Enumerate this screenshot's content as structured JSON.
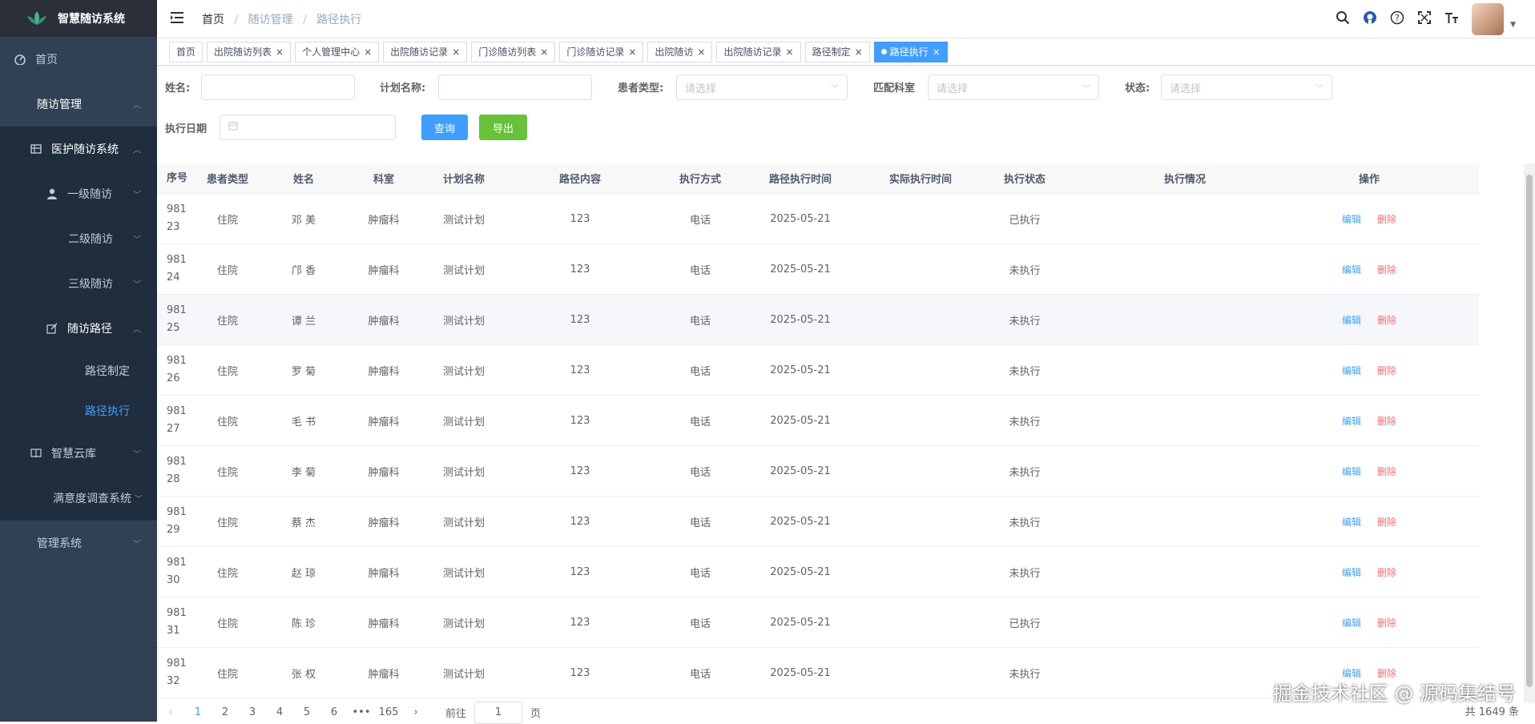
{
  "app": {
    "title": "智慧随访系统"
  },
  "sidebar": {
    "items": [
      {
        "label": "首页",
        "icon": "dashboard-icon"
      },
      {
        "label": "随访管理",
        "icon": ""
      },
      {
        "label": "医护随访系统",
        "icon": "table-icon"
      },
      {
        "label": "一级随访",
        "icon": "user-icon"
      },
      {
        "label": "二级随访",
        "icon": ""
      },
      {
        "label": "三级随访",
        "icon": ""
      },
      {
        "label": "随访路径",
        "icon": "edit-icon"
      },
      {
        "label": "路径制定",
        "icon": ""
      },
      {
        "label": "路径执行",
        "icon": ""
      },
      {
        "label": "智慧云库",
        "icon": "book-icon"
      },
      {
        "label": "满意度调查系统",
        "icon": ""
      },
      {
        "label": "管理系统",
        "icon": ""
      }
    ]
  },
  "breadcrumb": {
    "home": "首页",
    "section": "随访管理",
    "page": "路径执行"
  },
  "tags": [
    "首页",
    "出院随访列表",
    "个人管理中心",
    "出院随访记录",
    "门诊随访列表",
    "门诊随访记录",
    "出院随访",
    "出院随访记录",
    "路径制定",
    "路径执行"
  ],
  "filters": {
    "name_label": "姓名:",
    "plan_label": "计划名称:",
    "ptype_label": "患者类型:",
    "ptype_placeholder": "请选择",
    "dept_label": "匹配科室",
    "dept_placeholder": "请选择",
    "status_label": "状态:",
    "status_placeholder": "请选择",
    "date_label": "执行日期",
    "query_button": "查询",
    "export_button": "导出"
  },
  "table": {
    "headers": [
      "序号",
      "患者类型",
      "姓名",
      "科室",
      "计划名称",
      "路径内容",
      "执行方式",
      "路径执行时间",
      "实际执行时间",
      "执行状态",
      "执行情况",
      "操作"
    ],
    "rows": [
      {
        "idx1": "981",
        "idx2": "23",
        "type": "住院",
        "name": "邓  美",
        "dept": "肿瘤科",
        "plan": "测试计划",
        "content": "123",
        "mode": "电话",
        "time": "2025-05-21",
        "actual": "",
        "status": "已执行",
        "situation": ""
      },
      {
        "idx1": "981",
        "idx2": "24",
        "type": "住院",
        "name": "邝  香",
        "dept": "肿瘤科",
        "plan": "测试计划",
        "content": "123",
        "mode": "电话",
        "time": "2025-05-21",
        "actual": "",
        "status": "未执行",
        "situation": ""
      },
      {
        "idx1": "981",
        "idx2": "25",
        "type": "住院",
        "name": "谭  兰",
        "dept": "肿瘤科",
        "plan": "测试计划",
        "content": "123",
        "mode": "电话",
        "time": "2025-05-21",
        "actual": "",
        "status": "未执行",
        "situation": ""
      },
      {
        "idx1": "981",
        "idx2": "26",
        "type": "住院",
        "name": "罗  菊",
        "dept": "肿瘤科",
        "plan": "测试计划",
        "content": "123",
        "mode": "电话",
        "time": "2025-05-21",
        "actual": "",
        "status": "未执行",
        "situation": ""
      },
      {
        "idx1": "981",
        "idx2": "27",
        "type": "住院",
        "name": "毛  书",
        "dept": "肿瘤科",
        "plan": "测试计划",
        "content": "123",
        "mode": "电话",
        "time": "2025-05-21",
        "actual": "",
        "status": "未执行",
        "situation": ""
      },
      {
        "idx1": "981",
        "idx2": "28",
        "type": "住院",
        "name": "李  菊",
        "dept": "肿瘤科",
        "plan": "测试计划",
        "content": "123",
        "mode": "电话",
        "time": "2025-05-21",
        "actual": "",
        "status": "未执行",
        "situation": ""
      },
      {
        "idx1": "981",
        "idx2": "29",
        "type": "住院",
        "name": "蔡  杰",
        "dept": "肿瘤科",
        "plan": "测试计划",
        "content": "123",
        "mode": "电话",
        "time": "2025-05-21",
        "actual": "",
        "status": "未执行",
        "situation": ""
      },
      {
        "idx1": "981",
        "idx2": "30",
        "type": "住院",
        "name": "赵  琼",
        "dept": "肿瘤科",
        "plan": "测试计划",
        "content": "123",
        "mode": "电话",
        "time": "2025-05-21",
        "actual": "",
        "status": "未执行",
        "situation": ""
      },
      {
        "idx1": "981",
        "idx2": "31",
        "type": "住院",
        "name": "陈  珍",
        "dept": "肿瘤科",
        "plan": "测试计划",
        "content": "123",
        "mode": "电话",
        "time": "2025-05-21",
        "actual": "",
        "status": "已执行",
        "situation": ""
      },
      {
        "idx1": "981",
        "idx2": "32",
        "type": "住院",
        "name": "张  权",
        "dept": "肿瘤科",
        "plan": "测试计划",
        "content": "123",
        "mode": "电话",
        "time": "2025-05-21",
        "actual": "",
        "status": "未执行",
        "situation": ""
      }
    ],
    "edit_label": "编辑",
    "delete_label": "删除"
  },
  "pagination": {
    "pages": [
      "1",
      "2",
      "3",
      "4",
      "5",
      "6",
      "•••",
      "165"
    ],
    "goto_label": "前往",
    "goto_value": "1",
    "page_suffix": "页",
    "total": "共 1649 条"
  },
  "watermark": "掘金技术社区 @ 源码集结号",
  "colors": {
    "sidebar_bg": "#304156",
    "accent": "#409EFF",
    "success": "#67C23A",
    "danger": "#F56C6C"
  }
}
